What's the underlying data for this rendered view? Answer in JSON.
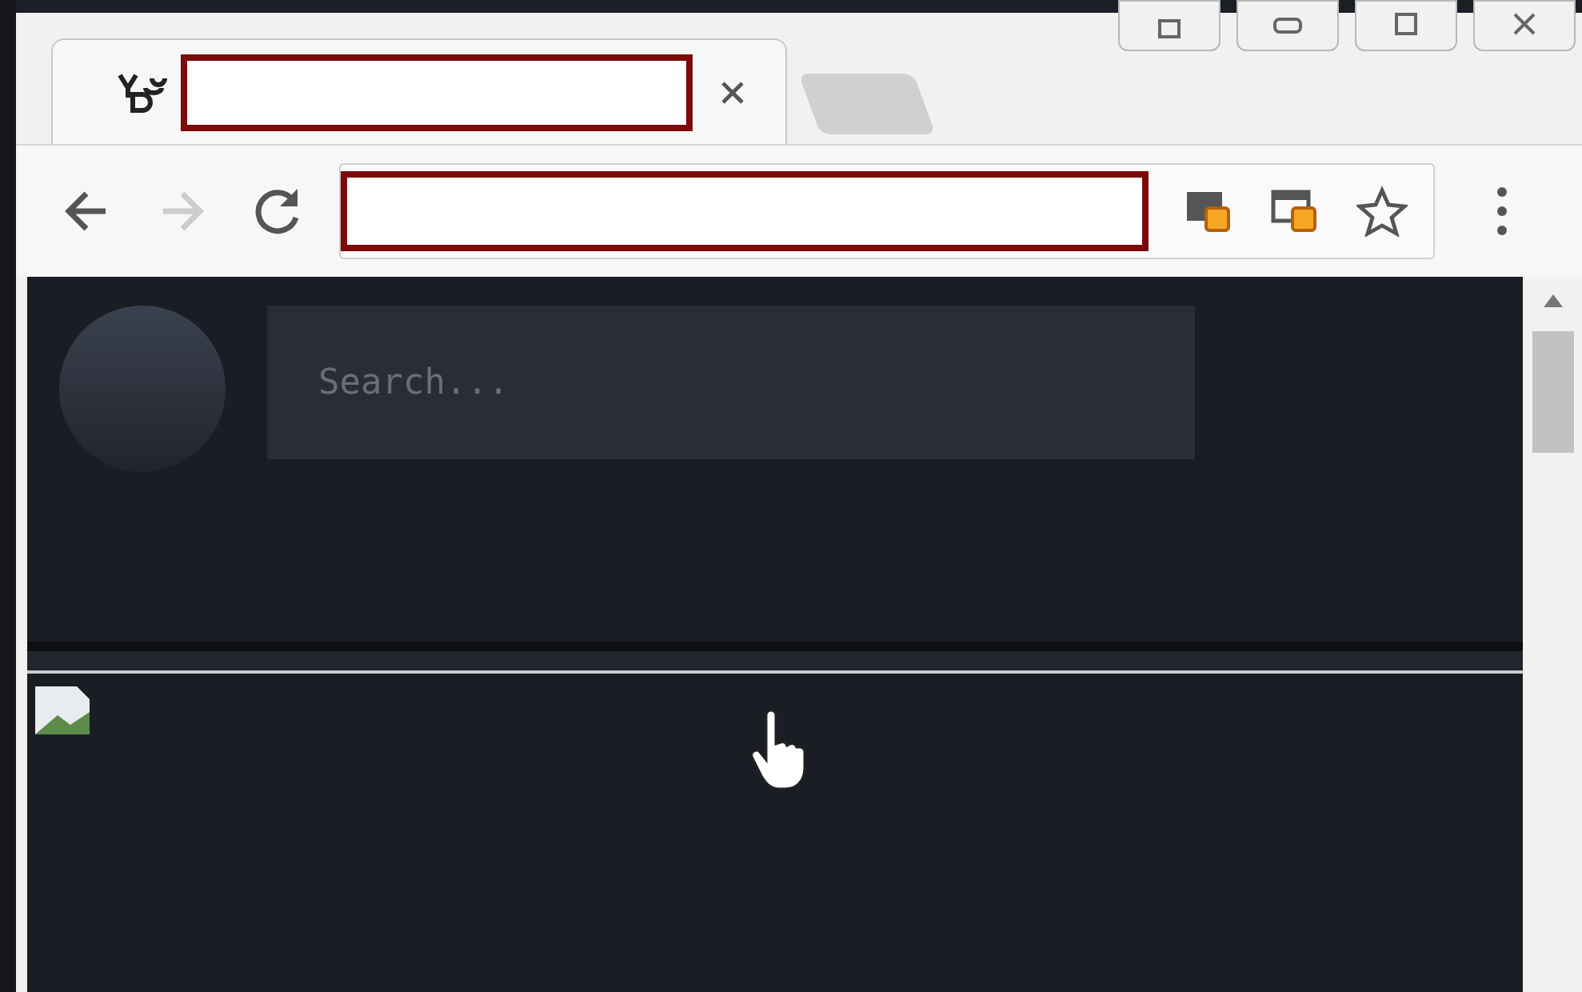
{
  "search": {
    "placeholder": "Search..."
  }
}
